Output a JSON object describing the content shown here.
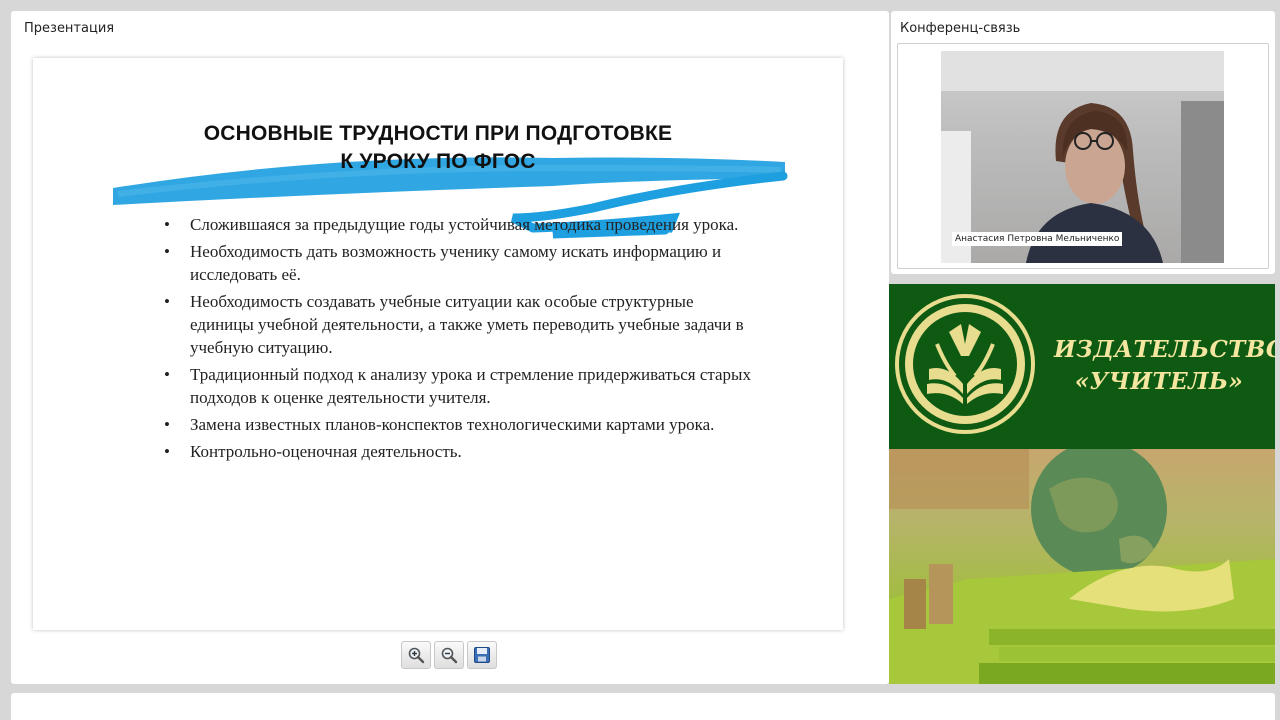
{
  "presentation": {
    "title": "Презентация",
    "slide": {
      "title_line_1": "ОСНОВНЫЕ  ТРУДНОСТИ ПРИ ПОДГОТОВКЕ",
      "title_line_2": "К УРОКУ ПО ФГОС",
      "bullet_symbol": "•",
      "bullets": [
        "Сложившаяся за предыдущие  годы устойчивая методика проведения урока.",
        "Необходимость дать возможность ученику самому искать информацию и исследовать её.",
        "Необходимость создавать учебные ситуации как особые структурные единицы учебной деятельности, а также уметь переводить учебные задачи в учебную ситуацию.",
        "Традиционный подход  к анализу урока и стремление придерживаться старых подходов к оценке деятельности учителя.",
        "Замена известных планов-конспектов технологическими картами урока.",
        "Контрольно-оценочная  деятельность."
      ],
      "brush_color": "#1e9fe0"
    },
    "toolbar": {
      "zoom_in_icon": "zoom-in-icon",
      "zoom_out_icon": "zoom-out-icon",
      "save_icon": "floppy-disk-icon"
    }
  },
  "conference": {
    "title": "Конференц-связь",
    "participant_name": "Анастасия Петровна Мельниченко"
  },
  "banner": {
    "line_1": "ИЗДАТЕЛЬСТВО",
    "line_2": "«УЧИТЕЛЬ»",
    "logo_icon": "open-book-tulip-logo-icon",
    "top_color": "#0e5a12",
    "text_color": "#f4e6a0"
  }
}
